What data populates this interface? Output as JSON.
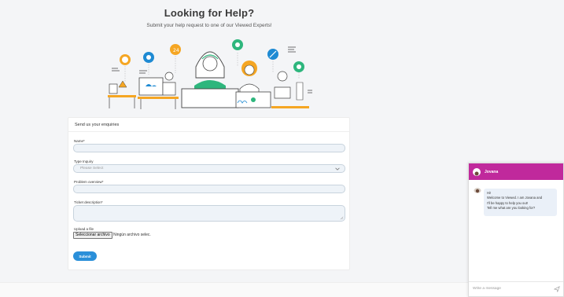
{
  "hero": {
    "title": "Looking for Help?",
    "subtitle": "Submit your help request to one of our Viewed Experts!"
  },
  "form": {
    "heading": "Send us your enquiries",
    "name_label": "Name*",
    "type_label": "Type Inquiry",
    "type_placeholder": "Please Select",
    "problem_label": "Problem overview*",
    "ticket_label": "Ticket description*",
    "upload_label": "Upload a file",
    "file_button": "Seleccionar archivo",
    "file_status": "Ningún archivo selec.",
    "submit_label": "Submit"
  },
  "chat": {
    "agent_name": "Jovana",
    "messages": [
      "Hi!",
      "Welcome to Viewed. I am Jovana and",
      "I'll be happy to help you out!",
      "Tell me what are you looking for?"
    ],
    "input_placeholder": "Write a message"
  },
  "colors": {
    "chat_header": "#c0299c",
    "submit_button": "#2a8fd9",
    "field_fill": "#eef3f8"
  }
}
